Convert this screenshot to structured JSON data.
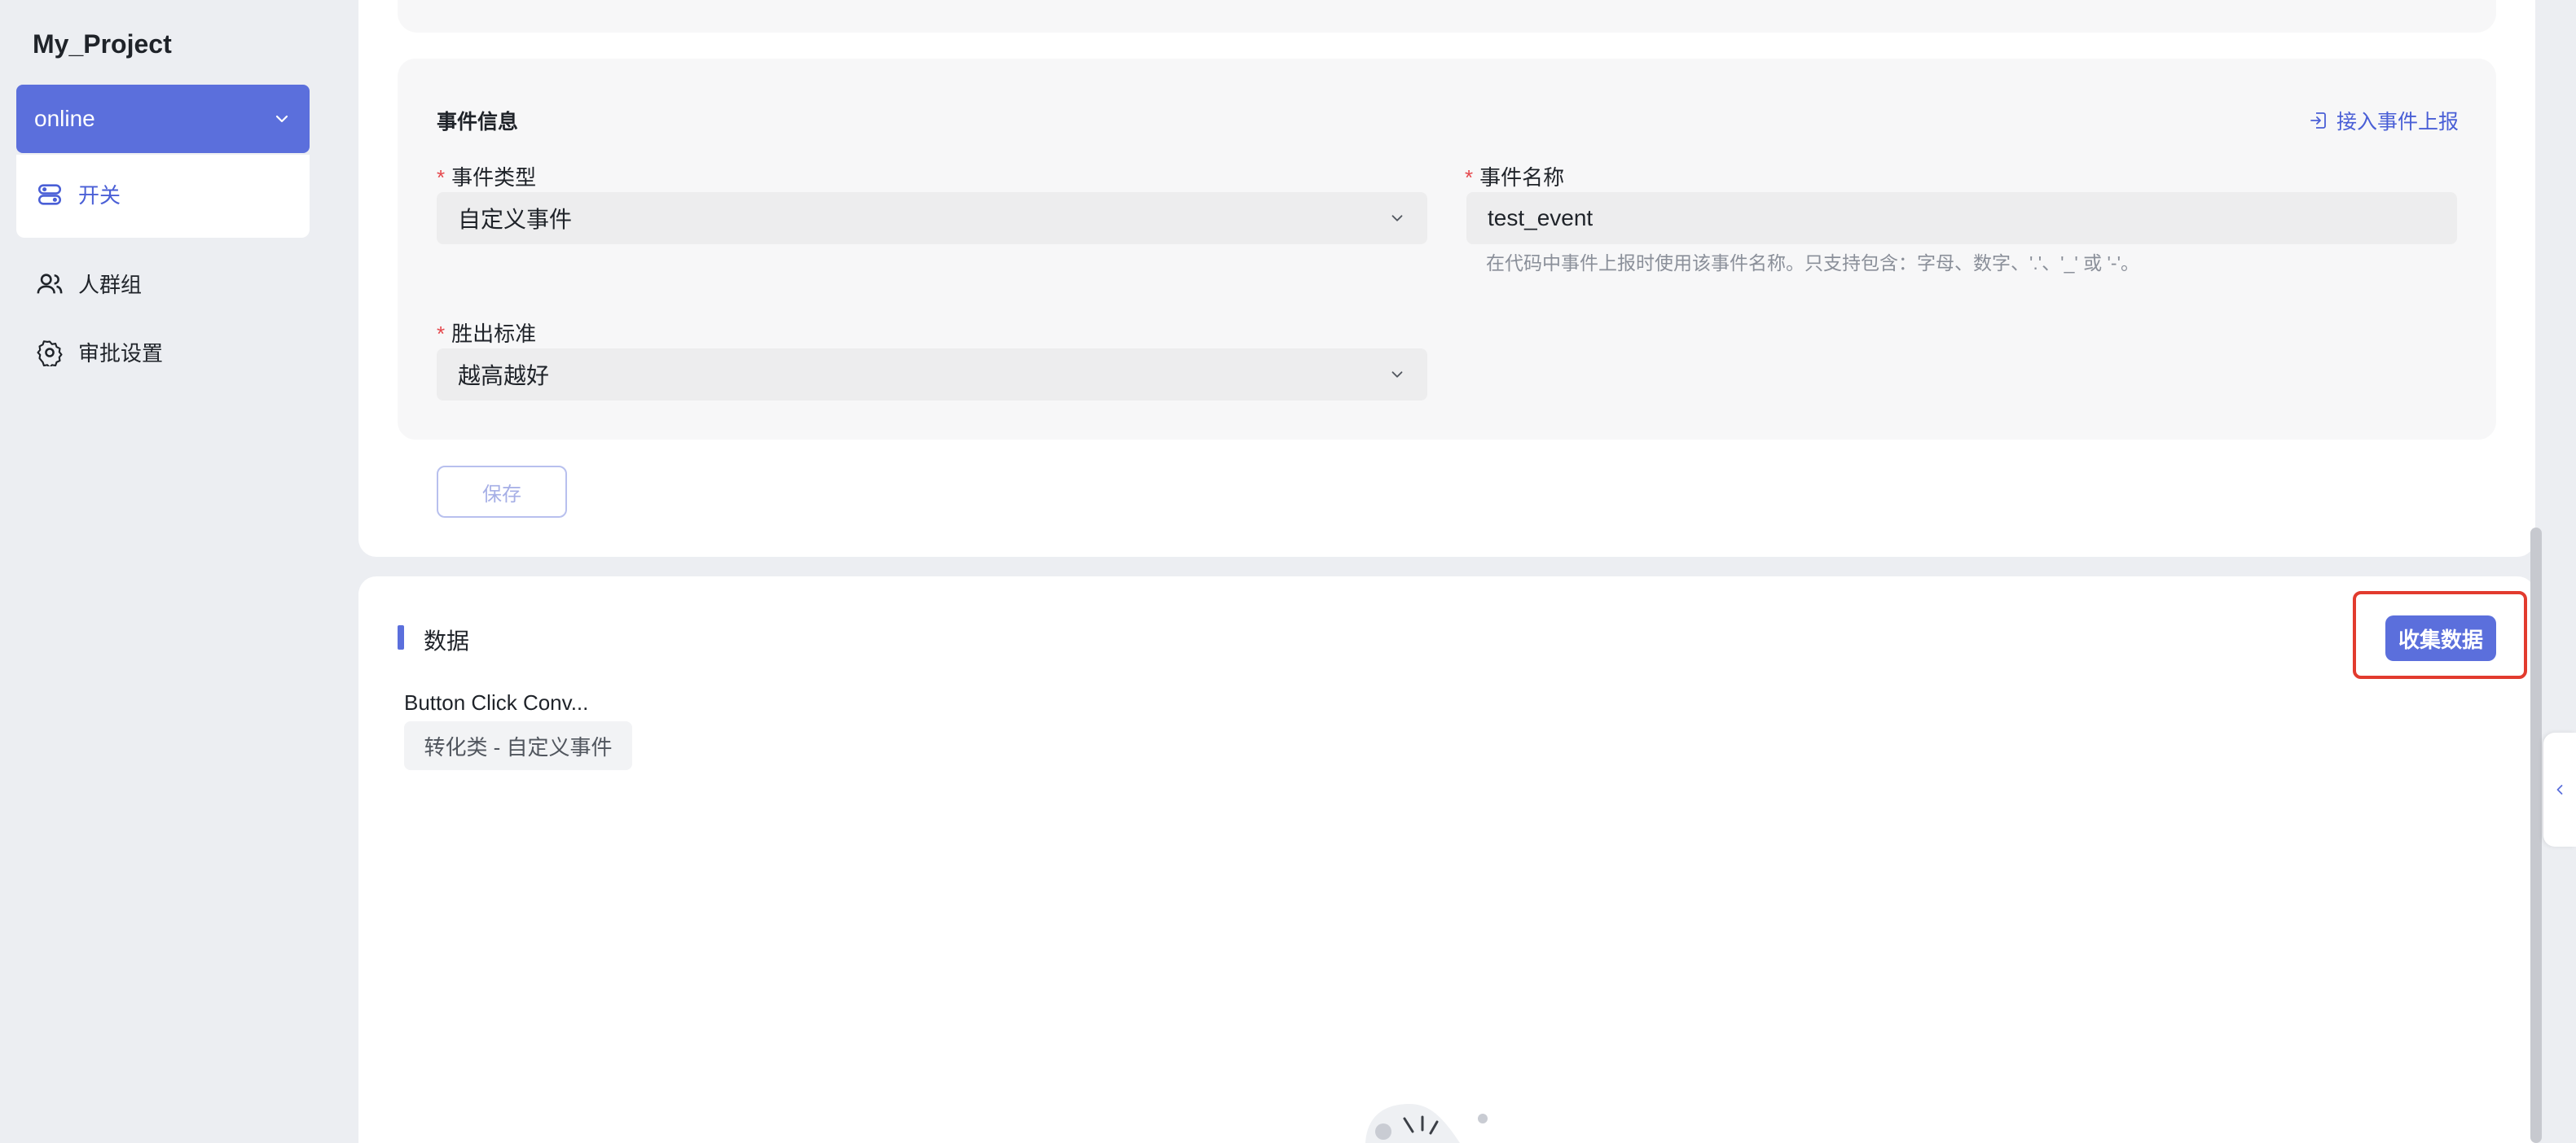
{
  "sidebar": {
    "project_title": "My_Project",
    "env_select": "online",
    "items": [
      {
        "label": "开关",
        "icon": "toggle-icon"
      },
      {
        "label": "人群组",
        "icon": "users-icon"
      },
      {
        "label": "审批设置",
        "icon": "gear-icon"
      }
    ]
  },
  "event_info": {
    "title": "事件信息",
    "link_label": "接入事件上报",
    "event_type": {
      "label": "事件类型",
      "value": "自定义事件"
    },
    "event_name": {
      "label": "事件名称",
      "value": "test_event",
      "hint": "在代码中事件上报时使用该事件名称。只支持包含：字母、数字、'.'、'_' 或 '-'。"
    },
    "win_criteria": {
      "label": "胜出标准",
      "value": "越高越好"
    },
    "save_label": "保存"
  },
  "data_section": {
    "title": "数据",
    "collect_label": "收集数据",
    "metric_name": "Button Click Conv...",
    "metric_tag": "转化类 - 自定义事件"
  },
  "colors": {
    "accent": "#5b6fdc",
    "highlight": "#e23b2e",
    "required": "#e5484d"
  }
}
